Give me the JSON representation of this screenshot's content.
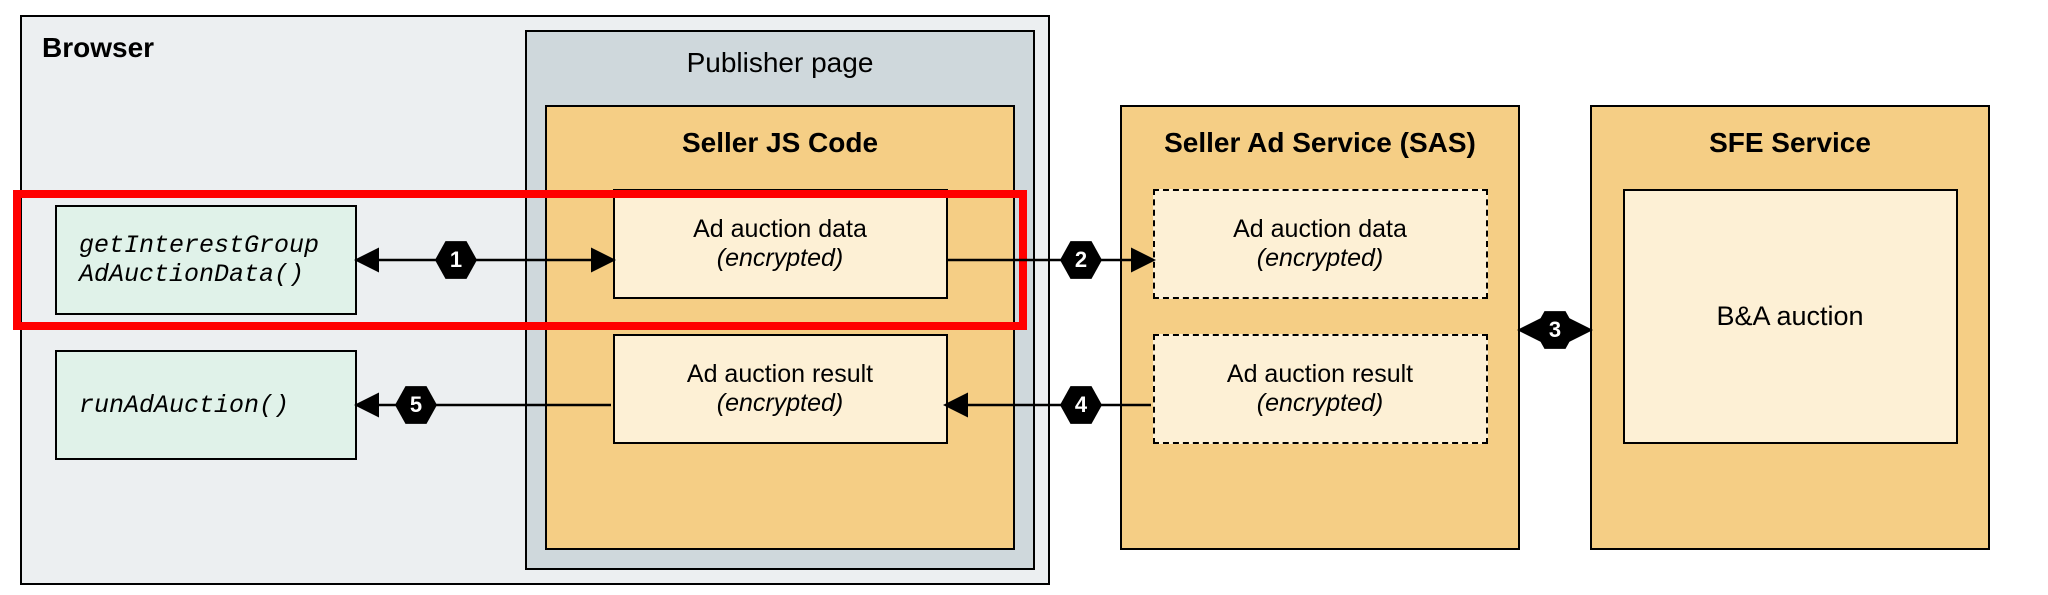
{
  "browser": {
    "title": "Browser",
    "publisher_title": "Publisher page",
    "api1_line1": "getInterestGroup",
    "api1_line2": "AdAuctionData()",
    "api2": "runAdAuction()"
  },
  "seller_js": {
    "title": "Seller JS Code",
    "data_card": "Ad auction data",
    "data_note": "(encrypted)",
    "result_card": "Ad auction result",
    "result_note": "(encrypted)"
  },
  "sas": {
    "title": "Seller Ad Service (SAS)",
    "data_card": "Ad auction data",
    "data_note": "(encrypted)",
    "result_card": "Ad auction result",
    "result_note": "(encrypted)"
  },
  "sfe": {
    "title": "SFE Service",
    "inner": "B&A auction"
  },
  "steps": {
    "s1": "1",
    "s2": "2",
    "s3": "3",
    "s4": "4",
    "s5": "5"
  }
}
